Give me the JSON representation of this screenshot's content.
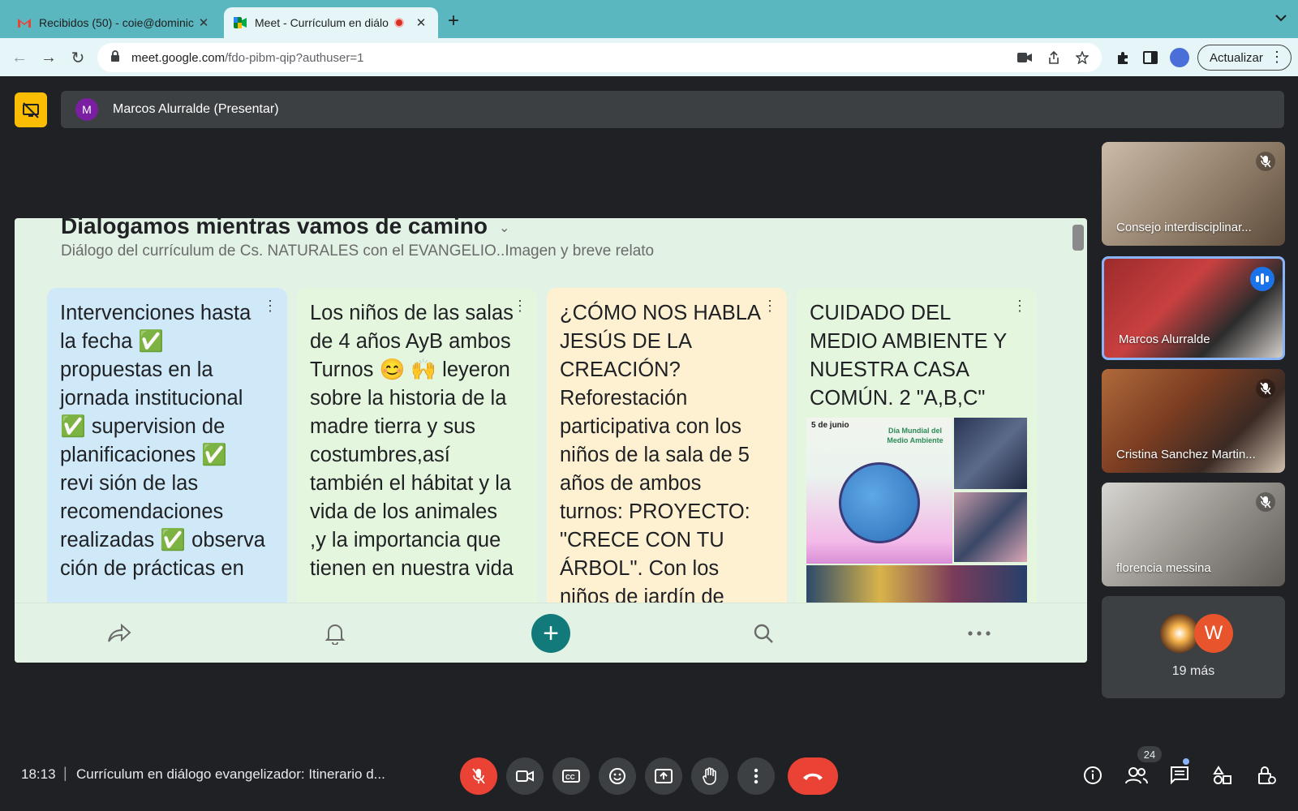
{
  "browser": {
    "tabs": [
      {
        "title": "Recibidos (50) - coie@dominic",
        "active": false
      },
      {
        "title": "Meet - Currículum en diálo",
        "active": true,
        "recording": true
      }
    ],
    "url_host": "meet.google.com",
    "url_path": "/fdo-pibm-qip?authuser=1",
    "update_label": "Actualizar"
  },
  "meet": {
    "presenter_initial": "M",
    "presenter_label": "Marcos Alurralde (Presentar)",
    "clock": "18:13",
    "meeting_title": "Currículum en diálogo evangelizador: Itinerario d...",
    "participant_count": "24",
    "participants": [
      {
        "name": "Consejo interdisciplinar...",
        "muted": true
      },
      {
        "name": "Marcos Alurralde",
        "muted": false,
        "speaking": true
      },
      {
        "name": "Cristina Sanchez Martin...",
        "muted": true
      },
      {
        "name": "florencia messina",
        "muted": true
      }
    ],
    "more": {
      "avatar_letter": "W",
      "label": "19 más"
    }
  },
  "board": {
    "title": "Dialogamos mientras vamos de camino",
    "subtitle": "Diálogo del currículum de Cs. NATURALES con el EVANGELIO..Imagen y breve relato",
    "cards": [
      {
        "text": "Intervenciones hasta la fecha ✅ propuestas en la jornada institucional ✅ supervision de planificaciones ✅ revi sión de las recomendaciones realizadas ✅ observa ción de prácticas en"
      },
      {
        "text": "Los niños de las salas de 4 años AyB ambos Turnos 😊 🙌 leyeron sobre la historia de la madre tierra y sus costumbres,así también el hábitat y la vida de los animales ,y la importancia que tienen en nuestra vida"
      },
      {
        "text": "¿CÓMO NOS HABLA JESÚS DE LA CREACIÓN? Reforestación participativa con los niños de la sala de 5 años de ambos turnos: PROYECTO: \"CRECE CON TU ÁRBOL\". Con los niños de jardín de infantes y"
      },
      {
        "text": "CUIDADO DEL MEDIO AMBIENTE Y NUESTRA CASA COMÚN. 2 \"A,B,C\"",
        "image_date": "5 de junio",
        "image_caption": "Día Mundial del Medio Ambiente"
      }
    ]
  }
}
